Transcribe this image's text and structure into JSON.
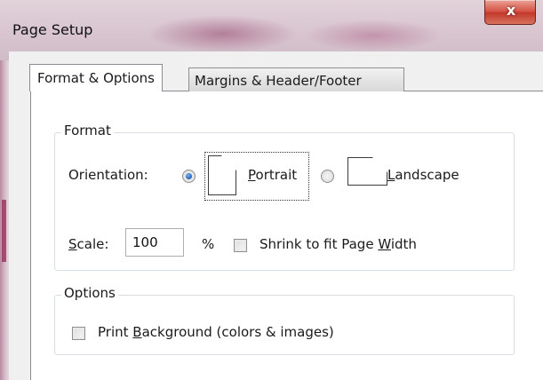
{
  "window": {
    "title": "Page Setup",
    "close_glyph": "x"
  },
  "tabs": [
    {
      "label": "Format & Options",
      "active": true
    },
    {
      "label": "Margins & Header/Footer",
      "active": false
    }
  ],
  "format": {
    "legend": "Format",
    "orientation_label": "Orientation:",
    "orientation_selected": "Portrait",
    "portrait": {
      "prefix": "",
      "mnemonic": "P",
      "rest": "ortrait"
    },
    "landscape": {
      "prefix": "",
      "mnemonic": "L",
      "rest": "andscape"
    },
    "scale_label": {
      "mnemonic": "S",
      "rest": "cale:"
    },
    "scale_value": "100",
    "percent": "%",
    "shrink": {
      "prefix": "Shrink to fit Page ",
      "mnemonic": "W",
      "rest": "idth",
      "checked": false
    }
  },
  "options": {
    "legend": "Options",
    "print_background": {
      "prefix": "Print ",
      "mnemonic": "B",
      "rest": "ackground (colors & images)",
      "checked": false
    }
  },
  "colors": {
    "radio_selected": "#1f5fbf",
    "close_button": "#c2392a"
  },
  "icons": {
    "close": "close-icon",
    "portrait_page": "portrait-page-icon",
    "landscape_page": "landscape-page-icon"
  }
}
